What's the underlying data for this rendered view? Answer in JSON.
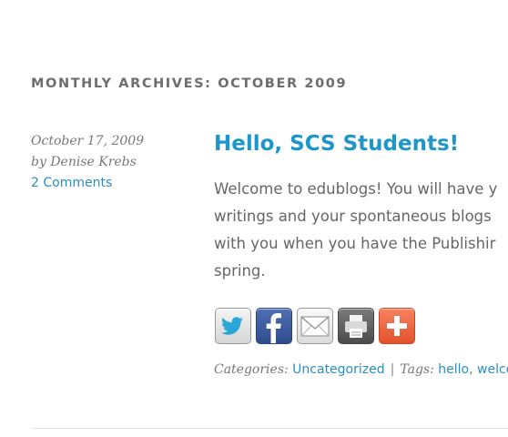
{
  "archive": {
    "title": "MONTHLY ARCHIVES: OCTOBER 2009"
  },
  "post": {
    "date": "October 17, 2009",
    "byline": "by Denise Krebs",
    "comments_link": "2 Comments",
    "title": "Hello, SCS Students!",
    "body_lines": [
      "Welcome to edublogs! You will have y",
      "writings and your spontaneous blogs",
      "with you when you have the Publishir",
      "spring."
    ],
    "share_buttons": [
      {
        "icon": "twitter-icon"
      },
      {
        "icon": "facebook-icon"
      },
      {
        "icon": "email-icon"
      },
      {
        "icon": "print-icon"
      },
      {
        "icon": "plus-icon"
      }
    ],
    "categories_label": "Categories:",
    "category": "Uncategorized",
    "separator": "|",
    "tags_label": "Tags:",
    "tags": [
      "hello",
      "welcor"
    ]
  },
  "colors": {
    "link": "#2a8fc0",
    "title": "#1f96c8",
    "text": "#666666"
  }
}
